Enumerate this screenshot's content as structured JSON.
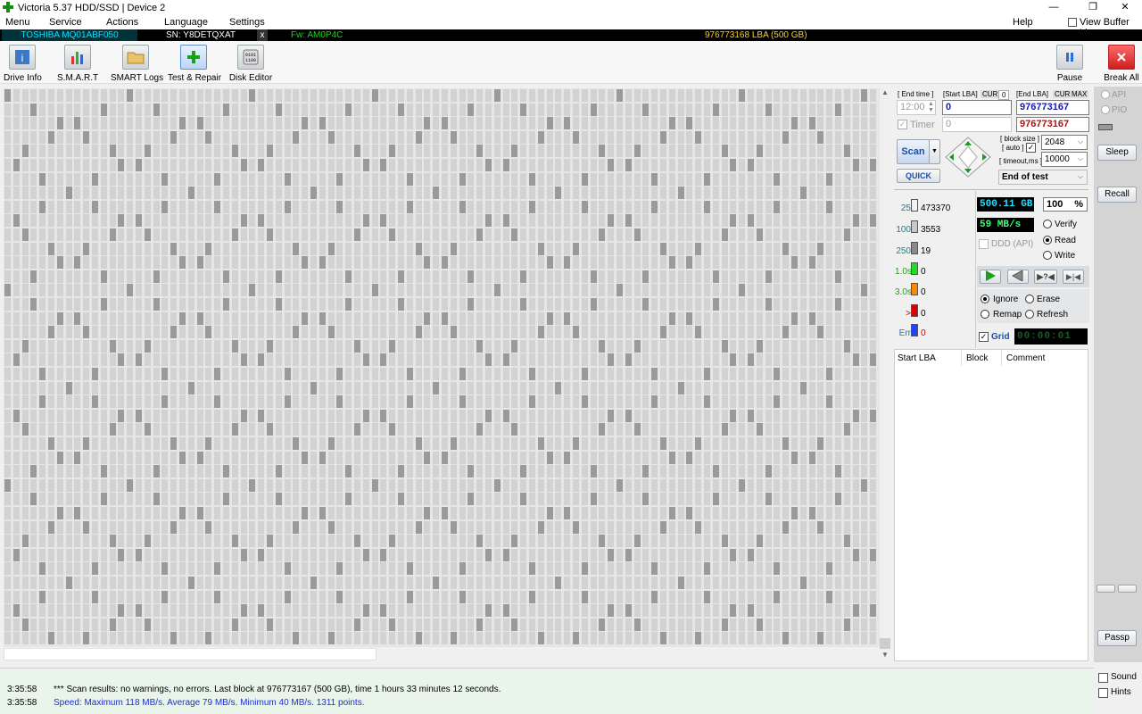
{
  "window": {
    "title": "Victoria 5.37 HDD/SSD | Device 2",
    "min": "—",
    "restore": "❐",
    "close": "✕"
  },
  "menu": {
    "items": [
      "Menu",
      "Service",
      "Actions",
      "Language",
      "Settings"
    ],
    "help": "Help",
    "view_buffer": "View Buffer Live"
  },
  "device": {
    "model": "TOSHIBA MQ01ABF050",
    "serial": "SN: Y8DETQXAT",
    "close": "x",
    "firmware": "Fw: AM0P4C",
    "lba": "976773168 LBA (500 GB)"
  },
  "toolbar": {
    "drive_info": "Drive Info",
    "smart": "S.M.A.R.T",
    "smart_logs": "SMART Logs",
    "test_repair": "Test & Repair",
    "disk_editor": "Disk Editor",
    "pause": "Pause",
    "break_all": "Break All"
  },
  "params": {
    "end_time_label": "[ End time ]",
    "start_lba_label": "[Start LBA]",
    "cur_label": "CUR",
    "cur_value": "0",
    "end_lba_label": "[End LBA]",
    "cur2_label": "CUR",
    "max_label": "MAX",
    "time_value": "12:00",
    "start_lba": "0",
    "end_lba": "976773167",
    "timer_label": "Timer",
    "timer_lba": "0",
    "end_lba_red": "976773167",
    "scan": "Scan",
    "quick": "QUICK",
    "block_size_label": "[ block size ]",
    "auto_label": "[ auto ]",
    "timeout_label": "[ timeout,ms ]",
    "block_size": "2048",
    "timeout": "10000",
    "end_action": "End of test"
  },
  "stats": [
    {
      "label": "25",
      "value": "473370",
      "color": "#f2f2f2",
      "text_color": "#2a7a8a"
    },
    {
      "label": "100",
      "value": "3553",
      "color": "#c8c8c8",
      "text_color": "#2a7a8a"
    },
    {
      "label": "250",
      "value": "19",
      "color": "#8a8a8a",
      "text_color": "#2a7a8a"
    },
    {
      "label": "1.0s",
      "value": "0",
      "color": "#22dd22",
      "text_color": "#20a020"
    },
    {
      "label": "3.0s",
      "value": "0",
      "color": "#ff8800",
      "text_color": "#20a020"
    },
    {
      "label": ">",
      "value": "0",
      "color": "#dd0000",
      "text_color": "#cc0000"
    },
    {
      "label": "Err",
      "value": "0",
      "color": "#2244ff",
      "text_color": "#2a7a8a"
    }
  ],
  "progress": {
    "size": "500.11 GB",
    "percent": "100",
    "percent_sign": "%",
    "speed": "59 MB/s",
    "ddd": "DDD (API)",
    "verify": "Verify",
    "read": "Read",
    "write": "Write"
  },
  "actions": {
    "ignore": "Ignore",
    "erase": "Erase",
    "remap": "Remap",
    "refresh": "Refresh",
    "grid": "Grid",
    "elapsed": "00:00:01"
  },
  "table": {
    "headers": [
      "Start LBA",
      "Block",
      "Comment"
    ]
  },
  "side": {
    "api": "API",
    "pio": "PIO",
    "sleep": "Sleep",
    "recall": "Recall",
    "passp": "Passp",
    "sound": "Sound",
    "hints": "Hints"
  },
  "log": [
    {
      "time": "3:35:58",
      "text": "*** Scan results: no warnings, no errors. Last block at 976773167 (500 GB), time 1 hours 33 minutes 12 seconds.",
      "color": "#000000"
    },
    {
      "time": "3:35:58",
      "text": "Speed: Maximum 118 MB/s. Average 79 MB/s. Minimum 40 MB/s. 1311 points.",
      "color": "#1a2fd6"
    }
  ]
}
